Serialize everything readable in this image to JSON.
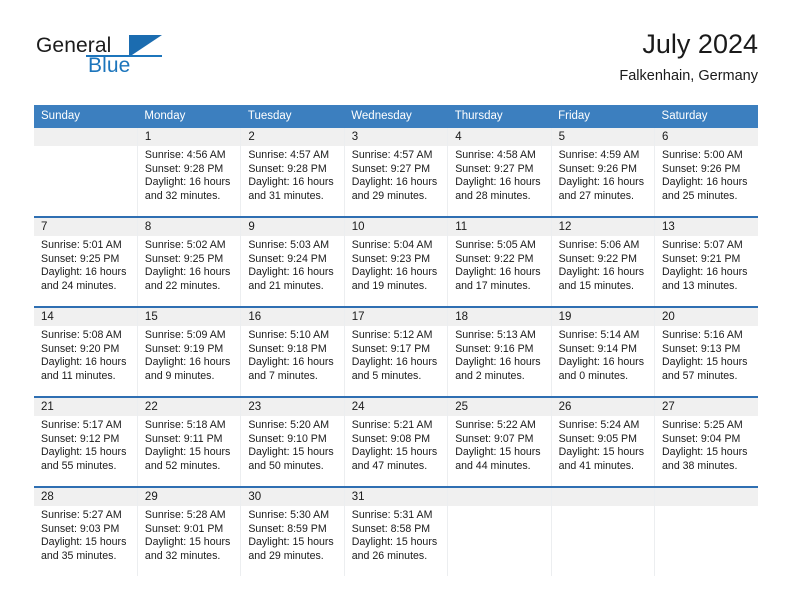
{
  "brand": {
    "word1": "General",
    "word2": "Blue",
    "flag_icon": "triangle-flag-icon",
    "colors": {
      "blue": "#1c75bc",
      "flag": "#1b6cb0",
      "dark": "#1b1b1b"
    }
  },
  "header": {
    "title": "July 2024",
    "subtitle": "Falkenhain, Germany"
  },
  "calendar": {
    "colors": {
      "header_bg": "#3c7fbf",
      "header_text": "#ffffff",
      "row_separator": "#2f6fb2",
      "daynum_bg": "#f0f0f0",
      "cell_bg": "#ffffff",
      "cell_divider": "#eceef0"
    },
    "weekday_headers": [
      "Sunday",
      "Monday",
      "Tuesday",
      "Wednesday",
      "Thursday",
      "Friday",
      "Saturday"
    ],
    "weeks": [
      [
        {
          "day": "",
          "lines": []
        },
        {
          "day": "1",
          "lines": [
            "Sunrise: 4:56 AM",
            "Sunset: 9:28 PM",
            "Daylight: 16 hours",
            "and 32 minutes."
          ]
        },
        {
          "day": "2",
          "lines": [
            "Sunrise: 4:57 AM",
            "Sunset: 9:28 PM",
            "Daylight: 16 hours",
            "and 31 minutes."
          ]
        },
        {
          "day": "3",
          "lines": [
            "Sunrise: 4:57 AM",
            "Sunset: 9:27 PM",
            "Daylight: 16 hours",
            "and 29 minutes."
          ]
        },
        {
          "day": "4",
          "lines": [
            "Sunrise: 4:58 AM",
            "Sunset: 9:27 PM",
            "Daylight: 16 hours",
            "and 28 minutes."
          ]
        },
        {
          "day": "5",
          "lines": [
            "Sunrise: 4:59 AM",
            "Sunset: 9:26 PM",
            "Daylight: 16 hours",
            "and 27 minutes."
          ]
        },
        {
          "day": "6",
          "lines": [
            "Sunrise: 5:00 AM",
            "Sunset: 9:26 PM",
            "Daylight: 16 hours",
            "and 25 minutes."
          ]
        }
      ],
      [
        {
          "day": "7",
          "lines": [
            "Sunrise: 5:01 AM",
            "Sunset: 9:25 PM",
            "Daylight: 16 hours",
            "and 24 minutes."
          ]
        },
        {
          "day": "8",
          "lines": [
            "Sunrise: 5:02 AM",
            "Sunset: 9:25 PM",
            "Daylight: 16 hours",
            "and 22 minutes."
          ]
        },
        {
          "day": "9",
          "lines": [
            "Sunrise: 5:03 AM",
            "Sunset: 9:24 PM",
            "Daylight: 16 hours",
            "and 21 minutes."
          ]
        },
        {
          "day": "10",
          "lines": [
            "Sunrise: 5:04 AM",
            "Sunset: 9:23 PM",
            "Daylight: 16 hours",
            "and 19 minutes."
          ]
        },
        {
          "day": "11",
          "lines": [
            "Sunrise: 5:05 AM",
            "Sunset: 9:22 PM",
            "Daylight: 16 hours",
            "and 17 minutes."
          ]
        },
        {
          "day": "12",
          "lines": [
            "Sunrise: 5:06 AM",
            "Sunset: 9:22 PM",
            "Daylight: 16 hours",
            "and 15 minutes."
          ]
        },
        {
          "day": "13",
          "lines": [
            "Sunrise: 5:07 AM",
            "Sunset: 9:21 PM",
            "Daylight: 16 hours",
            "and 13 minutes."
          ]
        }
      ],
      [
        {
          "day": "14",
          "lines": [
            "Sunrise: 5:08 AM",
            "Sunset: 9:20 PM",
            "Daylight: 16 hours",
            "and 11 minutes."
          ]
        },
        {
          "day": "15",
          "lines": [
            "Sunrise: 5:09 AM",
            "Sunset: 9:19 PM",
            "Daylight: 16 hours",
            "and 9 minutes."
          ]
        },
        {
          "day": "16",
          "lines": [
            "Sunrise: 5:10 AM",
            "Sunset: 9:18 PM",
            "Daylight: 16 hours",
            "and 7 minutes."
          ]
        },
        {
          "day": "17",
          "lines": [
            "Sunrise: 5:12 AM",
            "Sunset: 9:17 PM",
            "Daylight: 16 hours",
            "and 5 minutes."
          ]
        },
        {
          "day": "18",
          "lines": [
            "Sunrise: 5:13 AM",
            "Sunset: 9:16 PM",
            "Daylight: 16 hours",
            "and 2 minutes."
          ]
        },
        {
          "day": "19",
          "lines": [
            "Sunrise: 5:14 AM",
            "Sunset: 9:14 PM",
            "Daylight: 16 hours",
            "and 0 minutes."
          ]
        },
        {
          "day": "20",
          "lines": [
            "Sunrise: 5:16 AM",
            "Sunset: 9:13 PM",
            "Daylight: 15 hours",
            "and 57 minutes."
          ]
        }
      ],
      [
        {
          "day": "21",
          "lines": [
            "Sunrise: 5:17 AM",
            "Sunset: 9:12 PM",
            "Daylight: 15 hours",
            "and 55 minutes."
          ]
        },
        {
          "day": "22",
          "lines": [
            "Sunrise: 5:18 AM",
            "Sunset: 9:11 PM",
            "Daylight: 15 hours",
            "and 52 minutes."
          ]
        },
        {
          "day": "23",
          "lines": [
            "Sunrise: 5:20 AM",
            "Sunset: 9:10 PM",
            "Daylight: 15 hours",
            "and 50 minutes."
          ]
        },
        {
          "day": "24",
          "lines": [
            "Sunrise: 5:21 AM",
            "Sunset: 9:08 PM",
            "Daylight: 15 hours",
            "and 47 minutes."
          ]
        },
        {
          "day": "25",
          "lines": [
            "Sunrise: 5:22 AM",
            "Sunset: 9:07 PM",
            "Daylight: 15 hours",
            "and 44 minutes."
          ]
        },
        {
          "day": "26",
          "lines": [
            "Sunrise: 5:24 AM",
            "Sunset: 9:05 PM",
            "Daylight: 15 hours",
            "and 41 minutes."
          ]
        },
        {
          "day": "27",
          "lines": [
            "Sunrise: 5:25 AM",
            "Sunset: 9:04 PM",
            "Daylight: 15 hours",
            "and 38 minutes."
          ]
        }
      ],
      [
        {
          "day": "28",
          "lines": [
            "Sunrise: 5:27 AM",
            "Sunset: 9:03 PM",
            "Daylight: 15 hours",
            "and 35 minutes."
          ]
        },
        {
          "day": "29",
          "lines": [
            "Sunrise: 5:28 AM",
            "Sunset: 9:01 PM",
            "Daylight: 15 hours",
            "and 32 minutes."
          ]
        },
        {
          "day": "30",
          "lines": [
            "Sunrise: 5:30 AM",
            "Sunset: 8:59 PM",
            "Daylight: 15 hours",
            "and 29 minutes."
          ]
        },
        {
          "day": "31",
          "lines": [
            "Sunrise: 5:31 AM",
            "Sunset: 8:58 PM",
            "Daylight: 15 hours",
            "and 26 minutes."
          ]
        },
        {
          "day": "",
          "lines": []
        },
        {
          "day": "",
          "lines": []
        },
        {
          "day": "",
          "lines": []
        }
      ]
    ]
  }
}
